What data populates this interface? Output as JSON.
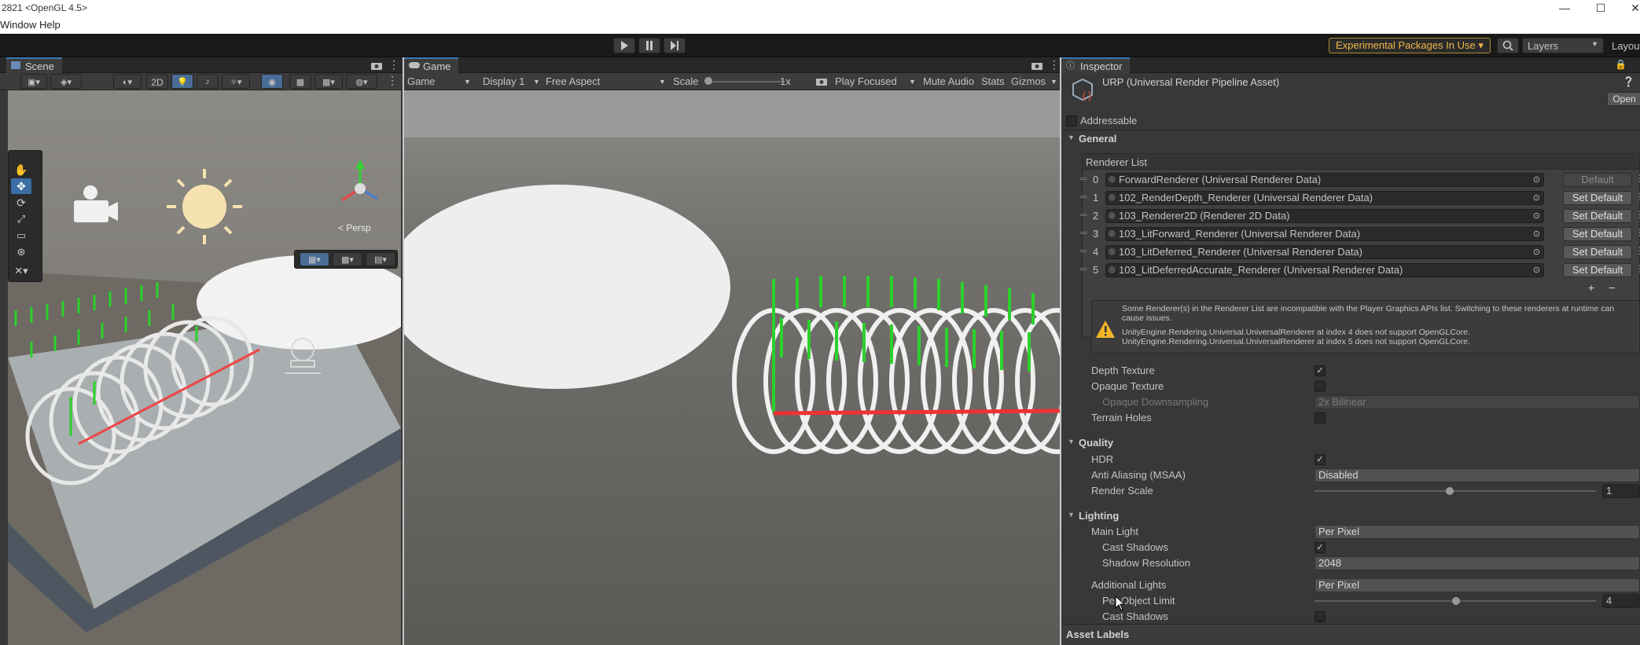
{
  "window": {
    "title": "2821 <OpenGL 4.5>",
    "menu": [
      "Window",
      "Help"
    ],
    "controls": {
      "minimize": "—",
      "maximize": "☐",
      "close": "✕"
    }
  },
  "toolbar": {
    "experimental": "Experimental Packages In Use ▾",
    "layers": "Layers",
    "layout": "Layout"
  },
  "scene": {
    "tab": "Scene",
    "btn_2d": "2D",
    "persp": "< Persp"
  },
  "game": {
    "tab": "Game",
    "mode": "Game",
    "display": "Display 1",
    "aspect": "Free Aspect",
    "scale_label": "Scale",
    "scale_value": "1x",
    "play_focused": "Play Focused",
    "mute": "Mute Audio",
    "stats": "Stats",
    "gizmos": "Gizmos"
  },
  "inspector": {
    "tab": "Inspector",
    "asset_title": "URP (Universal Render Pipeline Asset)",
    "open": "Open",
    "addressable": "Addressable",
    "general": "General",
    "renderer_list": "Renderer List",
    "renderers": [
      {
        "idx": "0",
        "name": "ForwardRenderer (Universal Renderer Data)",
        "btn": "Default"
      },
      {
        "idx": "1",
        "name": "102_RenderDepth_Renderer (Universal Renderer Data)",
        "btn": "Set Default"
      },
      {
        "idx": "2",
        "name": "103_Renderer2D (Renderer 2D Data)",
        "btn": "Set Default"
      },
      {
        "idx": "3",
        "name": "103_LitForward_Renderer (Universal Renderer Data)",
        "btn": "Set Default"
      },
      {
        "idx": "4",
        "name": "103_LitDeferred_Renderer (Universal Renderer Data)",
        "btn": "Set Default"
      },
      {
        "idx": "5",
        "name": "103_LitDeferredAccurate_Renderer (Universal Renderer Data)",
        "btn": "Set Default"
      }
    ],
    "plus": "+",
    "minus": "−",
    "warning": [
      "Some Renderer(s) in the Renderer List are incompatible with the Player Graphics APIs list.  Switching to these renderers at runtime can",
      "cause issues.",
      "UnityEngine.Rendering.Universal.UniversalRenderer at index 4 does not support OpenGLCore.",
      "UnityEngine.Rendering.Universal.UniversalRenderer at index 5 does not support OpenGLCore."
    ],
    "depth_texture": "Depth Texture",
    "opaque_texture": "Opaque Texture",
    "opaque_downsampling": "Opaque Downsampling",
    "opaque_downsampling_value": "2x Bilinear",
    "terrain_holes": "Terrain Holes",
    "quality": "Quality",
    "hdr": "HDR",
    "msaa": "Anti Aliasing (MSAA)",
    "msaa_value": "Disabled",
    "render_scale": "Render Scale",
    "render_scale_value": "1",
    "lighting": "Lighting",
    "main_light": "Main Light",
    "main_light_value": "Per Pixel",
    "cast_shadows": "Cast Shadows",
    "shadow_resolution": "Shadow Resolution",
    "shadow_resolution_value": "2048",
    "additional_lights": "Additional Lights",
    "additional_lights_value": "Per Pixel",
    "per_object_limit": "Per Object Limit",
    "per_object_limit_value": "4",
    "cast_shadows_2": "Cast Shadows",
    "asset_labels": "Asset Labels"
  },
  "colors": {
    "accent": "#3a79bb",
    "warning": "#f0b847",
    "panel": "#383838"
  }
}
